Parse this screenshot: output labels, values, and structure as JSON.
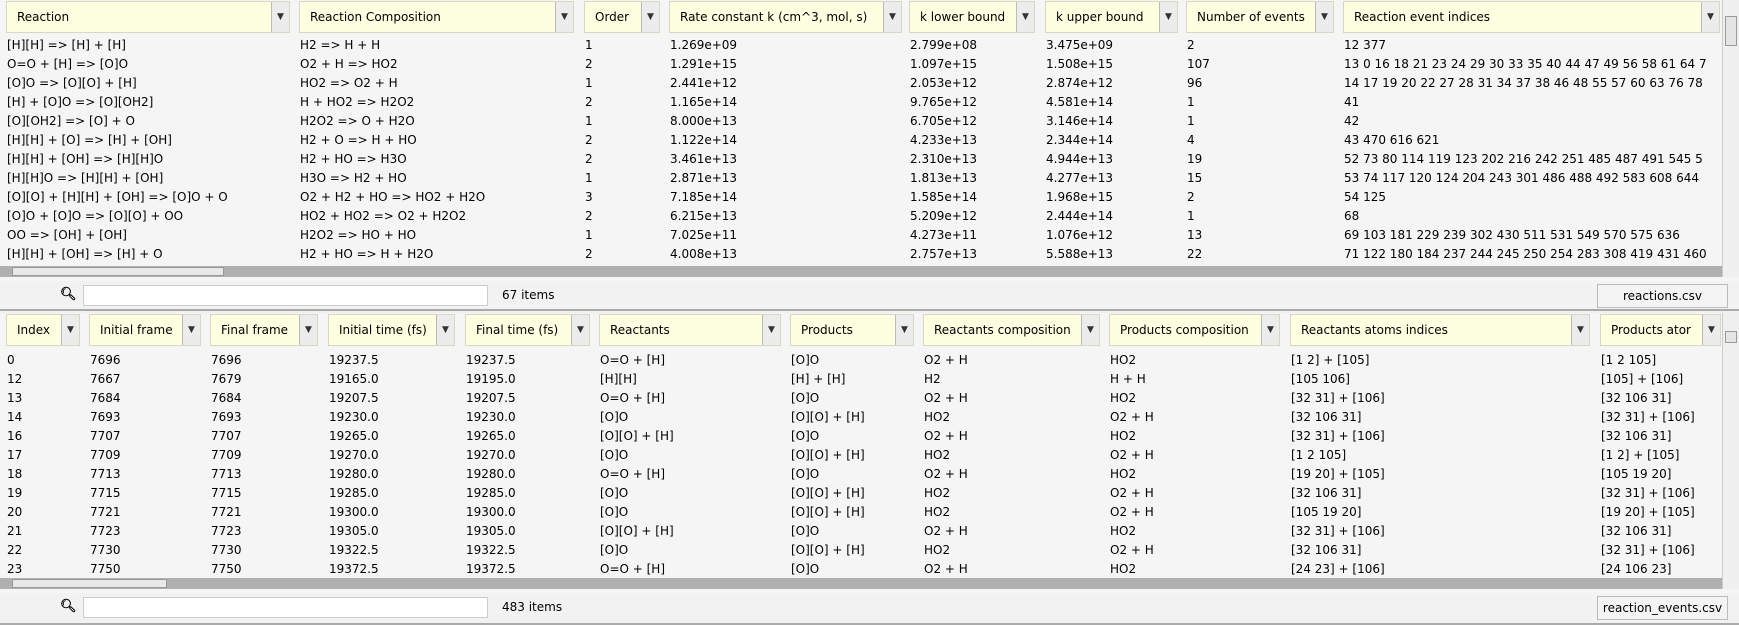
{
  "reactions_table": {
    "columns": [
      "Reaction",
      "Reaction Composition",
      "Order",
      "Rate constant k (cm^3, mol, s)",
      "k lower bound",
      "k upper bound",
      "Number of events",
      "Reaction event indices"
    ],
    "rows": [
      [
        "[H][H] => [H] + [H]",
        "H2 => H + H",
        "1",
        "1.269e+09",
        "2.799e+08",
        "3.475e+09",
        "2",
        "12 377"
      ],
      [
        "O=O + [H] => [O]O",
        "O2 + H => HO2",
        "2",
        "1.291e+15",
        "1.097e+15",
        "1.508e+15",
        "107",
        "13 0 16 18 21 23 24 29 30 33 35 40 44 47 49 56 58 61 64 7"
      ],
      [
        "[O]O => [O][O] + [H]",
        "HO2 => O2 + H",
        "1",
        "2.441e+12",
        "2.053e+12",
        "2.874e+12",
        "96",
        "14 17 19 20 22 27 28 31 34 37 38 46 48 55 57 60 63 76 78"
      ],
      [
        "[H] + [O]O => [O][OH2]",
        "H + HO2 => H2O2",
        "2",
        "1.165e+14",
        "9.765e+12",
        "4.581e+14",
        "1",
        "41"
      ],
      [
        "[O][OH2] => [O] + O",
        "H2O2 => O + H2O",
        "1",
        "8.000e+13",
        "6.705e+12",
        "3.146e+14",
        "1",
        "42"
      ],
      [
        "[H][H] + [O] => [H] + [OH]",
        "H2 + O => H + HO",
        "2",
        "1.122e+14",
        "4.233e+13",
        "2.344e+14",
        "4",
        "43 470 616 621"
      ],
      [
        "[H][H] + [OH] => [H][H]O",
        "H2 + HO => H3O",
        "2",
        "3.461e+13",
        "2.310e+13",
        "4.944e+13",
        "19",
        "52 73 80 114 119 123 202 216 242 251 485 487 491 545 5"
      ],
      [
        "[H][H]O => [H][H] + [OH]",
        "H3O => H2 + HO",
        "1",
        "2.871e+13",
        "1.813e+13",
        "4.277e+13",
        "15",
        "53 74 117 120 124 204 243 301 486 488 492 583 608 644"
      ],
      [
        "[O][O] + [H][H] + [OH] => [O]O + O",
        "O2 + H2 + HO => HO2 + H2O",
        "3",
        "7.185e+14",
        "1.585e+14",
        "1.968e+15",
        "2",
        "54 125"
      ],
      [
        "[O]O + [O]O => [O][O] + OO",
        "HO2 + HO2 => O2 + H2O2",
        "2",
        "6.215e+13",
        "5.209e+12",
        "2.444e+14",
        "1",
        "68"
      ],
      [
        "OO => [OH] + [OH]",
        "H2O2 => HO + HO",
        "1",
        "7.025e+11",
        "4.273e+11",
        "1.076e+12",
        "13",
        "69 103 181 229 239 302 430 511 531 549 570 575 636"
      ],
      [
        "[H][H] + [OH] => [H] + O",
        "H2 + HO => H + H2O",
        "2",
        "4.008e+13",
        "2.757e+13",
        "5.588e+13",
        "22",
        "71 122 180 184 237 244 245 250 254 283 308 419 431 460"
      ]
    ],
    "search_value": "",
    "count": "67 items",
    "export_label": "reactions.csv"
  },
  "events_table": {
    "columns": [
      "Index",
      "Initial frame",
      "Final frame",
      "Initial time (fs)",
      "Final time (fs)",
      "Reactants",
      "Products",
      "Reactants composition",
      "Products composition",
      "Reactants atoms indices",
      "Products ator"
    ],
    "rows": [
      [
        "0",
        "7696",
        "7696",
        "19237.5",
        "19237.5",
        "O=O + [H]",
        "[O]O",
        "O2 + H",
        "HO2",
        "[1 2] + [105]",
        "[1 2 105]"
      ],
      [
        "12",
        "7667",
        "7679",
        "19165.0",
        "19195.0",
        "[H][H]",
        "[H] + [H]",
        "H2",
        "H + H",
        "[105 106]",
        "[105] + [106]"
      ],
      [
        "13",
        "7684",
        "7684",
        "19207.5",
        "19207.5",
        "O=O + [H]",
        "[O]O",
        "O2 + H",
        "HO2",
        "[32 31] + [106]",
        "[32 106 31]"
      ],
      [
        "14",
        "7693",
        "7693",
        "19230.0",
        "19230.0",
        "[O]O",
        "[O][O] + [H]",
        "HO2",
        "O2 + H",
        "[32 106 31]",
        "[32 31] + [106]"
      ],
      [
        "16",
        "7707",
        "7707",
        "19265.0",
        "19265.0",
        "[O][O] + [H]",
        "[O]O",
        "O2 + H",
        "HO2",
        "[32 31] + [106]",
        "[32 106 31]"
      ],
      [
        "17",
        "7709",
        "7709",
        "19270.0",
        "19270.0",
        "[O]O",
        "[O][O] + [H]",
        "HO2",
        "O2 + H",
        "[1 2 105]",
        "[1 2] + [105]"
      ],
      [
        "18",
        "7713",
        "7713",
        "19280.0",
        "19280.0",
        "O=O + [H]",
        "[O]O",
        "O2 + H",
        "HO2",
        "[19 20] + [105]",
        "[105 19 20]"
      ],
      [
        "19",
        "7715",
        "7715",
        "19285.0",
        "19285.0",
        "[O]O",
        "[O][O] + [H]",
        "HO2",
        "O2 + H",
        "[32 106 31]",
        "[32 31] + [106]"
      ],
      [
        "20",
        "7721",
        "7721",
        "19300.0",
        "19300.0",
        "[O]O",
        "[O][O] + [H]",
        "HO2",
        "O2 + H",
        "[105 19 20]",
        "[19 20] + [105]"
      ],
      [
        "21",
        "7723",
        "7723",
        "19305.0",
        "19305.0",
        "[O][O] + [H]",
        "[O]O",
        "O2 + H",
        "HO2",
        "[32 31] + [106]",
        "[32 106 31]"
      ],
      [
        "22",
        "7730",
        "7730",
        "19322.5",
        "19322.5",
        "[O]O",
        "[O][O] + [H]",
        "HO2",
        "O2 + H",
        "[32 106 31]",
        "[32 31] + [106]"
      ],
      [
        "23",
        "7750",
        "7750",
        "19372.5",
        "19372.5",
        "O=O + [H]",
        "[O]O",
        "O2 + H",
        "HO2",
        "[24 23] + [106]",
        "[24 106 23]"
      ]
    ],
    "search_value": "",
    "count": "483 items",
    "export_label": "reaction_events.csv"
  },
  "icons": {
    "search": "search-icon",
    "dropdown": "chevron-down-icon"
  },
  "colors": {
    "header_bg": "#fefee0",
    "scrollbar": "#b0b0b0"
  }
}
